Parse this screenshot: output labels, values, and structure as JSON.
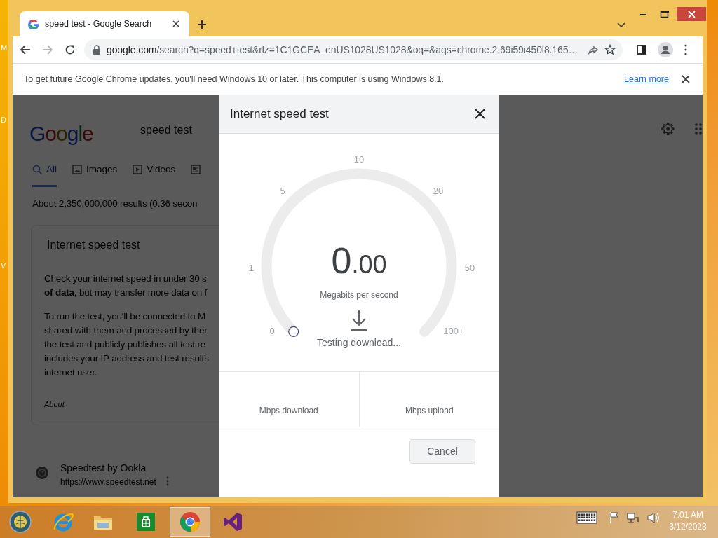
{
  "desktop": {
    "icon_labels": [
      "M",
      "D",
      "V"
    ]
  },
  "browser": {
    "tabs": [
      {
        "title": "speed test - Google Search",
        "selected": true
      }
    ],
    "address": {
      "host": "google.com",
      "path": "/search?q=speed+test&rlz=1C1GCEA_enUS1028US1028&oq=&aqs=chrome.2.69i59i450l8.165…"
    },
    "infobar": {
      "message": "To get future Google Chrome updates, you'll need Windows 10 or later. This computer is using Windows 8.1.",
      "link": "Learn more"
    }
  },
  "page": {
    "logo": "Google",
    "query": "speed test",
    "tabs": [
      {
        "label": "All",
        "kind": "search",
        "selected": true
      },
      {
        "label": "Images",
        "kind": "image",
        "selected": false
      },
      {
        "label": "Videos",
        "kind": "video",
        "selected": false
      },
      {
        "kind": "news",
        "selected": false
      }
    ],
    "result_stats": "About 2,350,000,000 results (0.36 secon",
    "card": {
      "title": "Internet speed test",
      "paragraphs": [
        [
          "Check your internet speed in under 30 s",
          "**of data**, but may transfer more data on f"
        ],
        [
          "To run the test, you'll be connected to M",
          "shared with them and processed by ther",
          "the test and publicly publishes all test re",
          "includes your IP address and test results",
          "internet user."
        ]
      ],
      "about": "About"
    },
    "result": {
      "title": "Speedtest by Ookla",
      "url": "https://www.speedtest.net"
    }
  },
  "dialog": {
    "title": "Internet speed test",
    "gauge": {
      "ticks": [
        "0",
        "1",
        "5",
        "10",
        "20",
        "50",
        "100+"
      ],
      "value_int": "0",
      "value_frac": ".00",
      "unit": "Megabits per second",
      "status": "Testing download..."
    },
    "stats": [
      {
        "label": "Mbps download"
      },
      {
        "label": "Mbps upload"
      }
    ],
    "cancel": "Cancel"
  },
  "taskbar": {
    "apps": [
      {
        "kind": "start",
        "selected": false
      },
      {
        "kind": "ie",
        "selected": false
      },
      {
        "kind": "explorer",
        "selected": false
      },
      {
        "kind": "store",
        "selected": false
      },
      {
        "kind": "chrome",
        "selected": true
      },
      {
        "kind": "vs",
        "selected": false
      }
    ],
    "time": "7:01 AM",
    "date": "3/12/2023"
  }
}
